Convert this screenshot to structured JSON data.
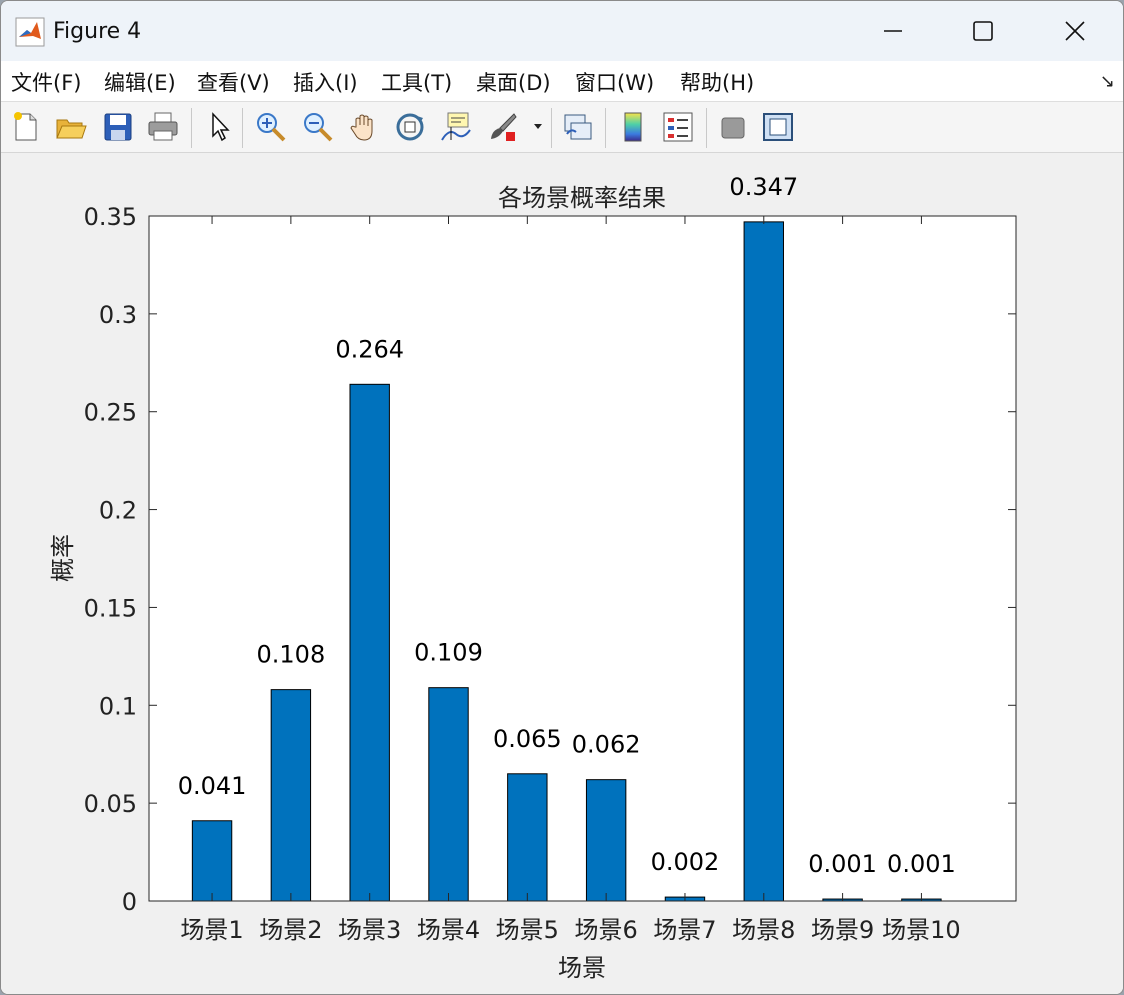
{
  "window": {
    "title": "Figure 4"
  },
  "menu": {
    "items": [
      "文件(F)",
      "编辑(E)",
      "查看(V)",
      "插入(I)",
      "工具(T)",
      "桌面(D)",
      "窗口(W)",
      "帮助(H)"
    ],
    "overflow_icon": "dock-arrow-icon"
  },
  "toolbar": {
    "icons": [
      "new-figure-icon",
      "open-file-icon",
      "save-icon",
      "print-icon",
      "select-pointer-icon",
      "zoom-in-icon",
      "zoom-out-icon",
      "pan-hand-icon",
      "rotate-3d-icon",
      "data-cursor-icon",
      "brush-icon",
      "brush-dropdown-icon",
      "link-plot-icon",
      "colorbar-icon",
      "legend-icon",
      "hide-plot-tools-icon",
      "show-plot-tools-icon"
    ]
  },
  "chart_data": {
    "type": "bar",
    "title": "各场景概率结果",
    "xlabel": "场景",
    "ylabel": "概率",
    "categories": [
      "场景1",
      "场景2",
      "场景3",
      "场景4",
      "场景5",
      "场景6",
      "场景7",
      "场景8",
      "场景9",
      "场景10"
    ],
    "values": [
      0.041,
      0.108,
      0.264,
      0.109,
      0.065,
      0.062,
      0.002,
      0.347,
      0.001,
      0.001
    ],
    "data_labels": [
      "0.041",
      "0.108",
      "0.264",
      "0.109",
      "0.065",
      "0.062",
      "0.002",
      "0.347",
      "0.001",
      "0.001"
    ],
    "yticks": [
      0,
      0.05,
      0.1,
      0.15,
      0.2,
      0.25,
      0.3,
      0.35
    ],
    "ytick_labels": [
      "0",
      "0.05",
      "0.1",
      "0.15",
      "0.2",
      "0.25",
      "0.3",
      "0.35"
    ],
    "ylim": [
      0,
      0.35
    ],
    "grid": false,
    "bar_color": "#0072BD",
    "box": true
  }
}
